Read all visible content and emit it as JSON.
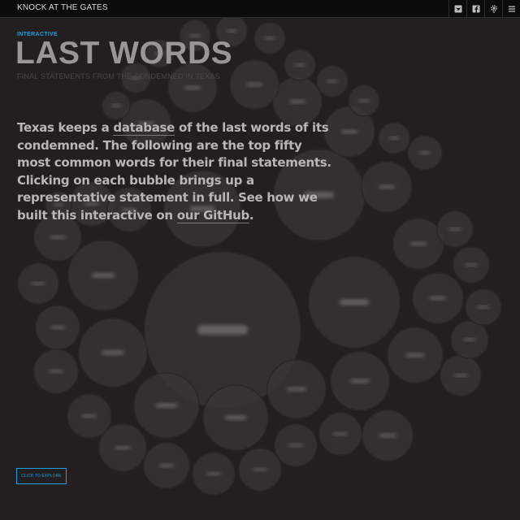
{
  "topbar": {
    "brand": "KNOCK AT THE GATES",
    "icons": [
      "twitter-icon",
      "facebook-icon",
      "settings-icon",
      "menu-icon"
    ]
  },
  "header": {
    "kicker": "INTERACTIVE",
    "title": "LAST WORDS",
    "subtitle": "FINAL STATEMENTS FROM THE CONDEMNED IN TEXAS"
  },
  "intro": {
    "part1": "Texas keeps a ",
    "database_link": "database",
    "part2": " of the last words of its condemned. The following are the top fifty most common words for their final statements. Clicking on each bubble brings up a representative statement in full. See how we built this interactive on ",
    "github_link": "our GitHub",
    "part3": "."
  },
  "cta": {
    "label": "CLICK TO EXPLORE"
  },
  "colors": {
    "background": "#231f20",
    "bubble": "#3a3637",
    "accent": "#1d9fe0",
    "title": "#9a9596",
    "body_text": "#bab4b5"
  }
}
